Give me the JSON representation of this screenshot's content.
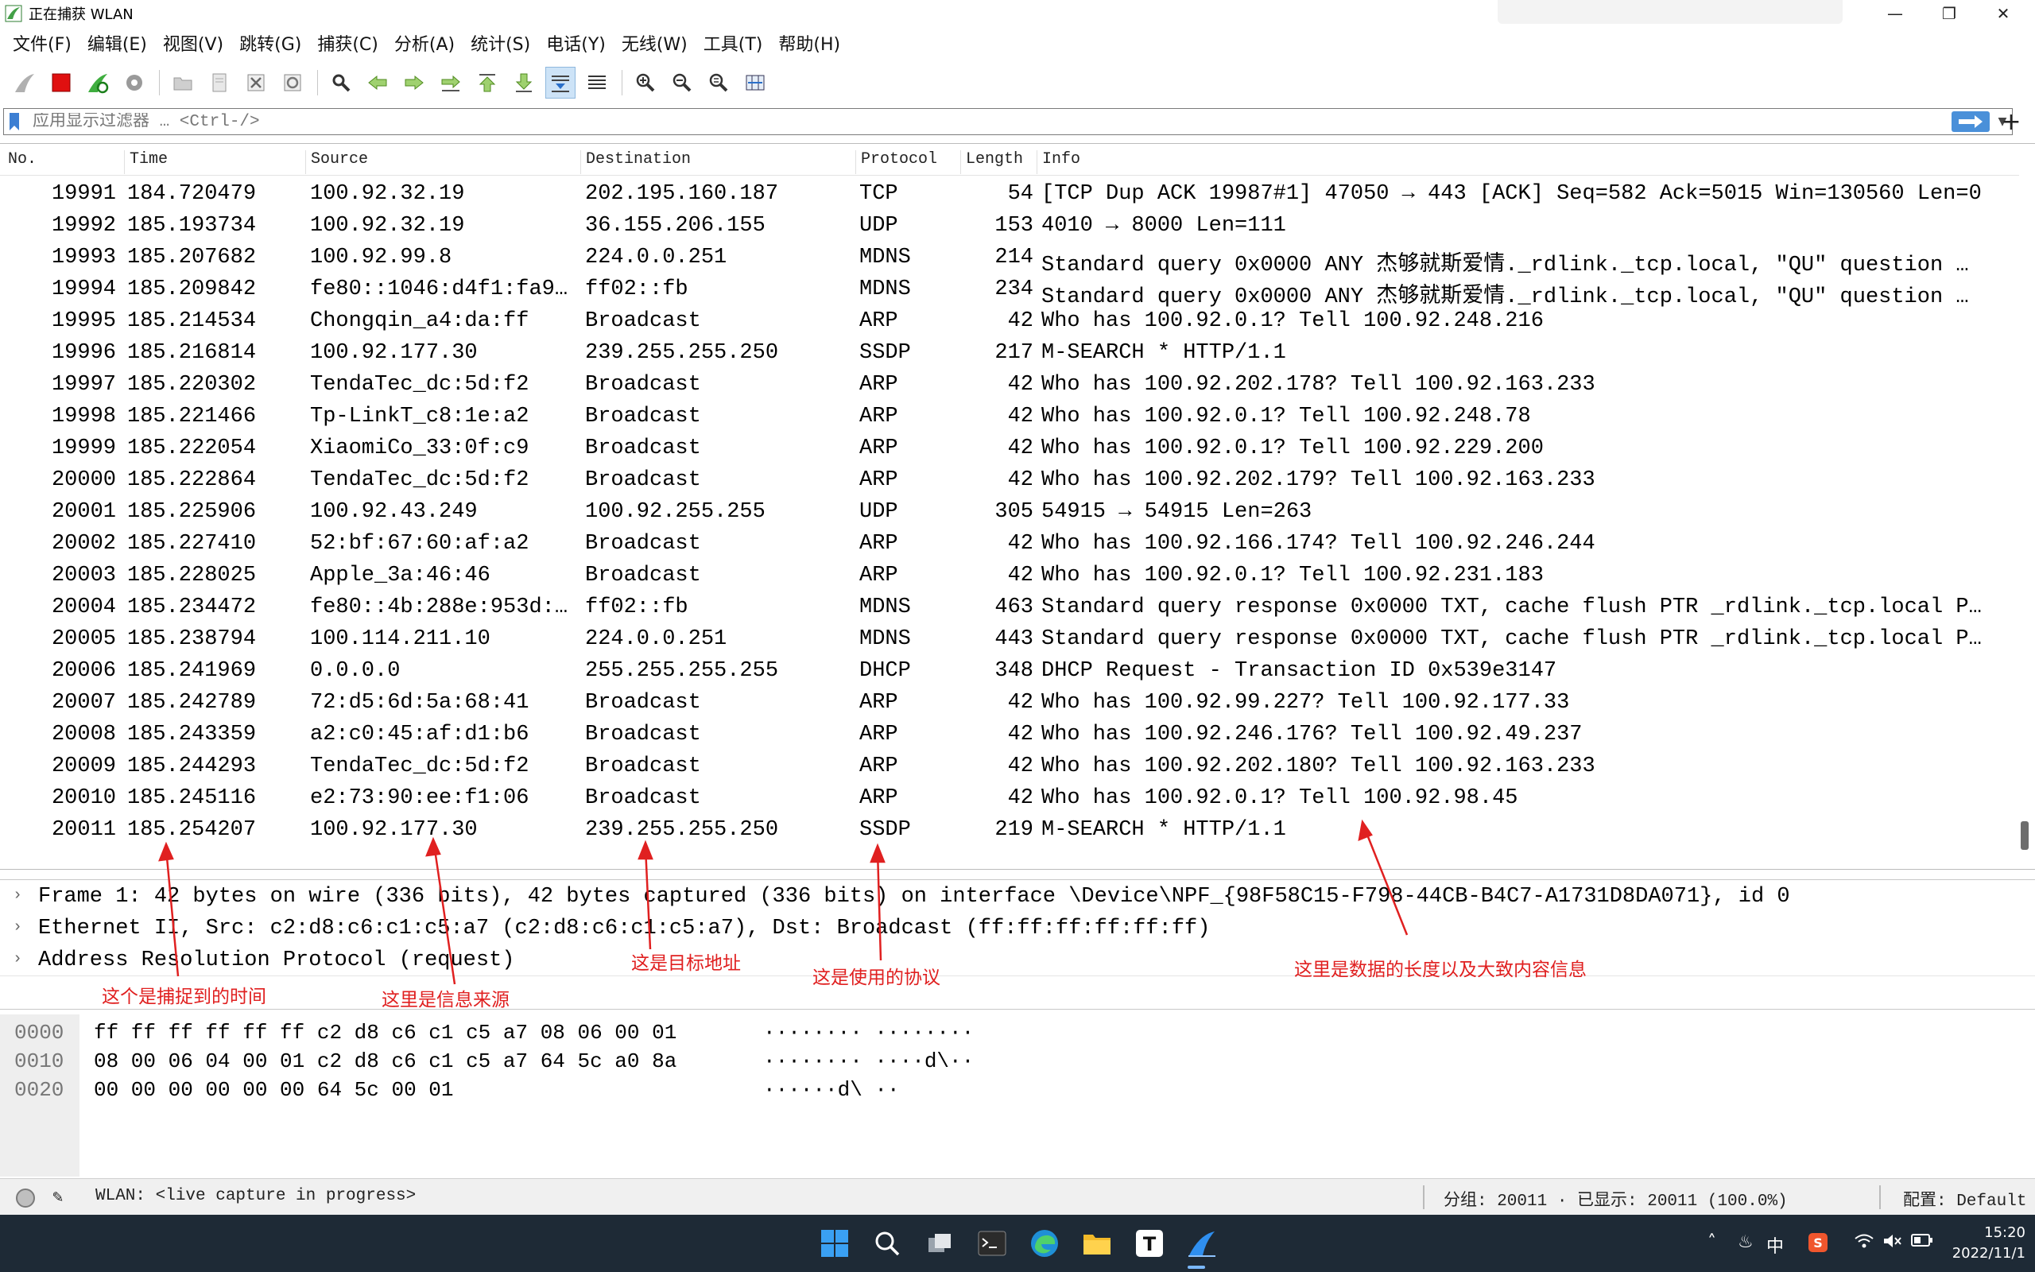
{
  "window": {
    "title": "正在捕获 WLAN",
    "controls": {
      "minimize": "—",
      "maximize": "❐",
      "close": "✕"
    }
  },
  "menu": [
    "文件(F)",
    "编辑(E)",
    "视图(V)",
    "跳转(G)",
    "捕获(C)",
    "分析(A)",
    "统计(S)",
    "电话(Y)",
    "无线(W)",
    "工具(T)",
    "帮助(H)"
  ],
  "filter": {
    "placeholder": "应用显示过滤器 … <Ctrl-/>",
    "plus": "+"
  },
  "packet_list": {
    "columns": [
      "No.",
      "Time",
      "Source",
      "Destination",
      "Protocol",
      "Length",
      "Info"
    ],
    "rows": [
      {
        "no": "19991",
        "time": "184.720479",
        "src": "100.92.32.19",
        "dst": "202.195.160.187",
        "proto": "TCP",
        "len": "54",
        "info": "[TCP Dup ACK 19987#1] 47050 → 443 [ACK] Seq=582 Ack=5015 Win=130560 Len=0"
      },
      {
        "no": "19992",
        "time": "185.193734",
        "src": "100.92.32.19",
        "dst": "36.155.206.155",
        "proto": "UDP",
        "len": "153",
        "info": "4010 → 8000 Len=111"
      },
      {
        "no": "19993",
        "time": "185.207682",
        "src": "100.92.99.8",
        "dst": "224.0.0.251",
        "proto": "MDNS",
        "len": "214",
        "info": "Standard query 0x0000 ANY 杰够就斯爱情._rdlink._tcp.local, \"QU\" question …"
      },
      {
        "no": "19994",
        "time": "185.209842",
        "src": "fe80::1046:d4f1:fa9…",
        "dst": "ff02::fb",
        "proto": "MDNS",
        "len": "234",
        "info": "Standard query 0x0000 ANY 杰够就斯爱情._rdlink._tcp.local, \"QU\" question …"
      },
      {
        "no": "19995",
        "time": "185.214534",
        "src": "Chongqin_a4:da:ff",
        "dst": "Broadcast",
        "proto": "ARP",
        "len": "42",
        "info": "Who has 100.92.0.1? Tell 100.92.248.216"
      },
      {
        "no": "19996",
        "time": "185.216814",
        "src": "100.92.177.30",
        "dst": "239.255.255.250",
        "proto": "SSDP",
        "len": "217",
        "info": "M-SEARCH * HTTP/1.1"
      },
      {
        "no": "19997",
        "time": "185.220302",
        "src": "TendaTec_dc:5d:f2",
        "dst": "Broadcast",
        "proto": "ARP",
        "len": "42",
        "info": "Who has 100.92.202.178? Tell 100.92.163.233"
      },
      {
        "no": "19998",
        "time": "185.221466",
        "src": "Tp-LinkT_c8:1e:a2",
        "dst": "Broadcast",
        "proto": "ARP",
        "len": "42",
        "info": "Who has 100.92.0.1? Tell 100.92.248.78"
      },
      {
        "no": "19999",
        "time": "185.222054",
        "src": "XiaomiCo_33:0f:c9",
        "dst": "Broadcast",
        "proto": "ARP",
        "len": "42",
        "info": "Who has 100.92.0.1? Tell 100.92.229.200"
      },
      {
        "no": "20000",
        "time": "185.222864",
        "src": "TendaTec_dc:5d:f2",
        "dst": "Broadcast",
        "proto": "ARP",
        "len": "42",
        "info": "Who has 100.92.202.179? Tell 100.92.163.233"
      },
      {
        "no": "20001",
        "time": "185.225906",
        "src": "100.92.43.249",
        "dst": "100.92.255.255",
        "proto": "UDP",
        "len": "305",
        "info": "54915 → 54915 Len=263"
      },
      {
        "no": "20002",
        "time": "185.227410",
        "src": "52:bf:67:60:af:a2",
        "dst": "Broadcast",
        "proto": "ARP",
        "len": "42",
        "info": "Who has 100.92.166.174? Tell 100.92.246.244"
      },
      {
        "no": "20003",
        "time": "185.228025",
        "src": "Apple_3a:46:46",
        "dst": "Broadcast",
        "proto": "ARP",
        "len": "42",
        "info": "Who has 100.92.0.1? Tell 100.92.231.183"
      },
      {
        "no": "20004",
        "time": "185.234472",
        "src": "fe80::4b:288e:953d:…",
        "dst": "ff02::fb",
        "proto": "MDNS",
        "len": "463",
        "info": "Standard query response 0x0000 TXT, cache flush PTR _rdlink._tcp.local P…"
      },
      {
        "no": "20005",
        "time": "185.238794",
        "src": "100.114.211.10",
        "dst": "224.0.0.251",
        "proto": "MDNS",
        "len": "443",
        "info": "Standard query response 0x0000 TXT, cache flush PTR _rdlink._tcp.local P…"
      },
      {
        "no": "20006",
        "time": "185.241969",
        "src": "0.0.0.0",
        "dst": "255.255.255.255",
        "proto": "DHCP",
        "len": "348",
        "info": "DHCP Request  - Transaction ID 0x539e3147"
      },
      {
        "no": "20007",
        "time": "185.242789",
        "src": "72:d5:6d:5a:68:41",
        "dst": "Broadcast",
        "proto": "ARP",
        "len": "42",
        "info": "Who has 100.92.99.227? Tell 100.92.177.33"
      },
      {
        "no": "20008",
        "time": "185.243359",
        "src": "a2:c0:45:af:d1:b6",
        "dst": "Broadcast",
        "proto": "ARP",
        "len": "42",
        "info": "Who has 100.92.246.176? Tell 100.92.49.237"
      },
      {
        "no": "20009",
        "time": "185.244293",
        "src": "TendaTec_dc:5d:f2",
        "dst": "Broadcast",
        "proto": "ARP",
        "len": "42",
        "info": "Who has 100.92.202.180? Tell 100.92.163.233"
      },
      {
        "no": "20010",
        "time": "185.245116",
        "src": "e2:73:90:ee:f1:06",
        "dst": "Broadcast",
        "proto": "ARP",
        "len": "42",
        "info": "Who has 100.92.0.1? Tell 100.92.98.45"
      },
      {
        "no": "20011",
        "time": "185.254207",
        "src": "100.92.177.30",
        "dst": "239.255.255.250",
        "proto": "SSDP",
        "len": "219",
        "info": "M-SEARCH * HTTP/1.1"
      }
    ]
  },
  "details": [
    "Frame 1: 42 bytes on wire (336 bits), 42 bytes captured (336 bits) on interface \\Device\\NPF_{98F58C15-F798-44CB-B4C7-A1731D8DA071}, id 0",
    "Ethernet II, Src: c2:d8:c6:c1:c5:a7 (c2:d8:c6:c1:c5:a7), Dst: Broadcast (ff:ff:ff:ff:ff:ff)",
    "Address Resolution Protocol (request)"
  ],
  "bytes": [
    {
      "offset": "0000",
      "hex": "ff ff ff ff ff ff c2 d8  c6 c1 c5 a7 08 06 00 01",
      "ascii": "········ ········"
    },
    {
      "offset": "0010",
      "hex": "08 00 06 04 00 01 c2 d8  c6 c1 c5 a7 64 5c a0 8a",
      "ascii": "········ ····d\\··"
    },
    {
      "offset": "0020",
      "hex": "00 00 00 00 00 00 64 5c  00 01",
      "ascii": "······d\\ ··"
    }
  ],
  "annotations": {
    "time": "这个是捕捉到的时间",
    "source": "这里是信息来源",
    "destination": "这是目标地址",
    "protocol": "这是使用的协议",
    "info": "这里是数据的长度以及大致内容信息"
  },
  "status": {
    "live": "WLAN: <live capture in progress>",
    "packets": "分组: 20011 · 已显示: 20011 (100.0%)",
    "profile": "配置: Default"
  },
  "taskbar": {
    "ime": "中",
    "time": "15:20",
    "date": "2022/11/1"
  },
  "colors": {
    "accent_blue": "#4a90d9",
    "annotation_red": "#e02020",
    "taskbar_bg": "#1e2a36"
  }
}
